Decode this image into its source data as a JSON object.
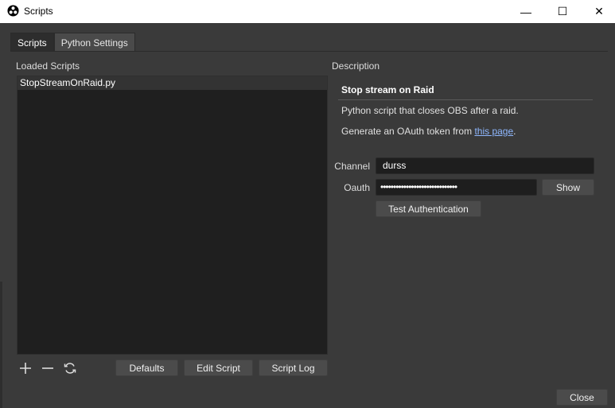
{
  "window": {
    "title": "Scripts",
    "controls": {
      "minimize": "—",
      "maximize": "☐",
      "close": "✕"
    }
  },
  "tabs": [
    {
      "label": "Scripts",
      "active": true
    },
    {
      "label": "Python Settings",
      "active": false
    }
  ],
  "loaded_scripts": {
    "label": "Loaded Scripts",
    "items": [
      "StopStreamOnRaid.py"
    ],
    "toolbar_icons": [
      "add-icon",
      "remove-icon",
      "reload-icon"
    ]
  },
  "buttons": {
    "defaults": "Defaults",
    "edit_script": "Edit Script",
    "script_log": "Script Log",
    "close": "Close"
  },
  "description": {
    "label": "Description",
    "title": "Stop stream on Raid",
    "line1": "Python script that closes OBS after a raid.",
    "line2_prefix": "Generate an OAuth token from ",
    "line2_link": "this page",
    "line2_suffix": "."
  },
  "form": {
    "channel_label": "Channel",
    "channel_value": "durss",
    "oauth_label": "Oauth",
    "oauth_value": "••••••••••••••••••••••••••••••",
    "show_label": "Show",
    "test_auth_label": "Test Authentication"
  },
  "colors": {
    "background": "#3a3a3a",
    "panel": "#1f1f1f",
    "button": "#4b4b4b",
    "link": "#8fb8ff"
  }
}
